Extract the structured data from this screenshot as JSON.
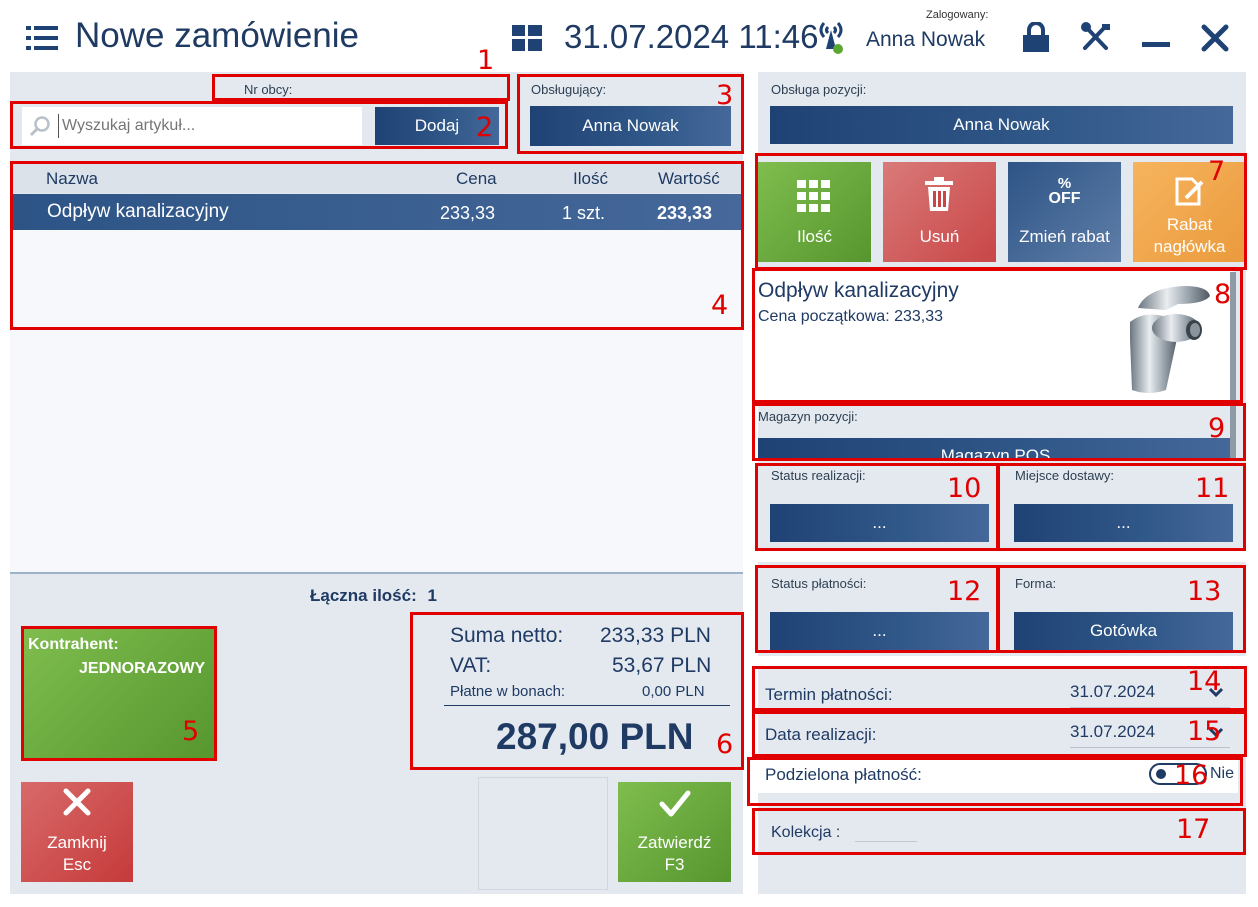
{
  "header": {
    "title": "Nowe zamówienie",
    "datetime": "31.07.2024 11:46",
    "logged_label": "Zalogowany:",
    "user": "Anna Nowak"
  },
  "left": {
    "nr_obcy_label": "Nr obcy:",
    "search_placeholder": "Wyszukaj artykuł...",
    "add_button": "Dodaj",
    "serving_label": "Obsługujący:",
    "serving_value": "Anna Nowak",
    "table": {
      "headers": [
        "Nazwa",
        "Cena",
        "Ilość",
        "Wartość"
      ],
      "rows": [
        {
          "name": "Odpływ kanalizacyjny",
          "price": "233,33",
          "qty": "1 szt.",
          "value": "233,33"
        }
      ]
    },
    "total_qty_label": "Łączna ilość:",
    "total_qty_value": "1",
    "contractor_label": "Kontrahent:",
    "contractor_value": "JEDNORAZOWY",
    "summary": {
      "net_label": "Suma netto:",
      "net_value": "233,33 PLN",
      "vat_label": "VAT:",
      "vat_value": "53,67 PLN",
      "vouchers_label": "Płatne w bonach:",
      "vouchers_value": "0,00 PLN",
      "total": "287,00 PLN"
    },
    "close_label": "Zamknij",
    "close_key": "Esc",
    "confirm_label": "Zatwierdź",
    "confirm_key": "F3"
  },
  "right": {
    "position_service_label": "Obsługa pozycji:",
    "position_service_value": "Anna Nowak",
    "tiles": {
      "qty": "Ilość",
      "delete": "Usuń",
      "discount_icon_top": "%",
      "discount_icon_bottom": "OFF",
      "discount": "Zmień rabat",
      "header_discount": "Rabat nagłówka"
    },
    "product_name": "Odpływ kanalizacyjny",
    "initial_price_label": "Cena początkowa:",
    "initial_price_value": "233,33",
    "warehouse_label": "Magazyn pozycji:",
    "warehouse_value": "Magazyn POS",
    "status_label": "Status realizacji:",
    "status_value": "...",
    "delivery_label": "Miejsce dostawy:",
    "delivery_value": "...",
    "payment_status_label": "Status płatności:",
    "payment_status_value": "...",
    "form_label": "Forma:",
    "form_value": "Gotówka",
    "payment_term_label": "Termin płatności:",
    "payment_term_value": "31.07.2024",
    "realization_label": "Data realizacji:",
    "realization_value": "31.07.2024",
    "split_label": "Podzielona płatność:",
    "split_value": "Nie",
    "collection_label": "Kolekcja :"
  },
  "callouts": [
    "1",
    "2",
    "3",
    "4",
    "5",
    "6",
    "7",
    "8",
    "9",
    "10",
    "11",
    "12",
    "13",
    "14",
    "15",
    "16",
    "17"
  ],
  "colors": {
    "accent": "#1f4274",
    "green": "#6aaa3c",
    "red": "#cf4f4f",
    "orange": "#f2a34a",
    "callout": "#e00000"
  }
}
